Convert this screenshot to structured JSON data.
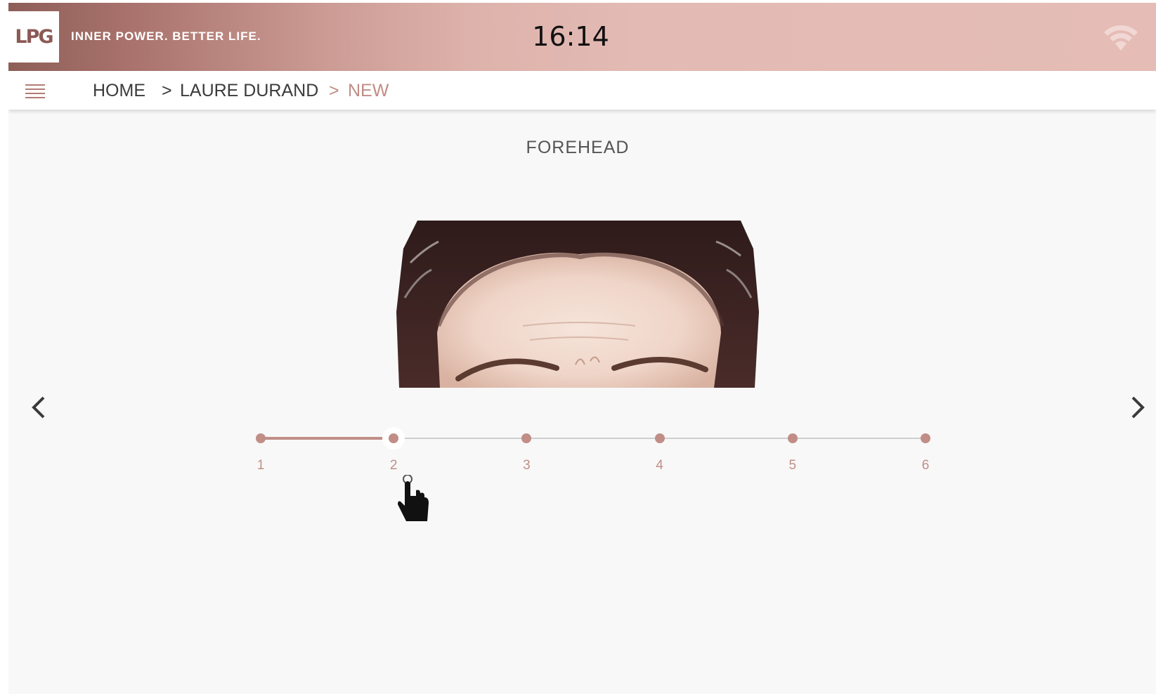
{
  "header": {
    "logo_text": "LPG",
    "tagline": "INNER POWER. BETTER LIFE.",
    "clock": "16:14",
    "wifi_icon": "wifi-icon"
  },
  "nav": {
    "menu_icon": "hamburger-menu-icon",
    "breadcrumbs": [
      {
        "label": "HOME"
      },
      {
        "label": "LAURE DURAND"
      },
      {
        "label": "NEW"
      }
    ],
    "separator": ">"
  },
  "main": {
    "section_title": "FOREHEAD",
    "prev_icon": "chevron-left-icon",
    "next_icon": "chevron-right-icon",
    "scale": {
      "levels": [
        "1",
        "2",
        "3",
        "4",
        "5",
        "6"
      ],
      "selected_index": 1
    }
  },
  "colors": {
    "accent": "#c08e87",
    "header_gradient_start": "#8d5e58",
    "header_gradient_end": "#e5bcb6",
    "background": "#f8f8f8"
  }
}
